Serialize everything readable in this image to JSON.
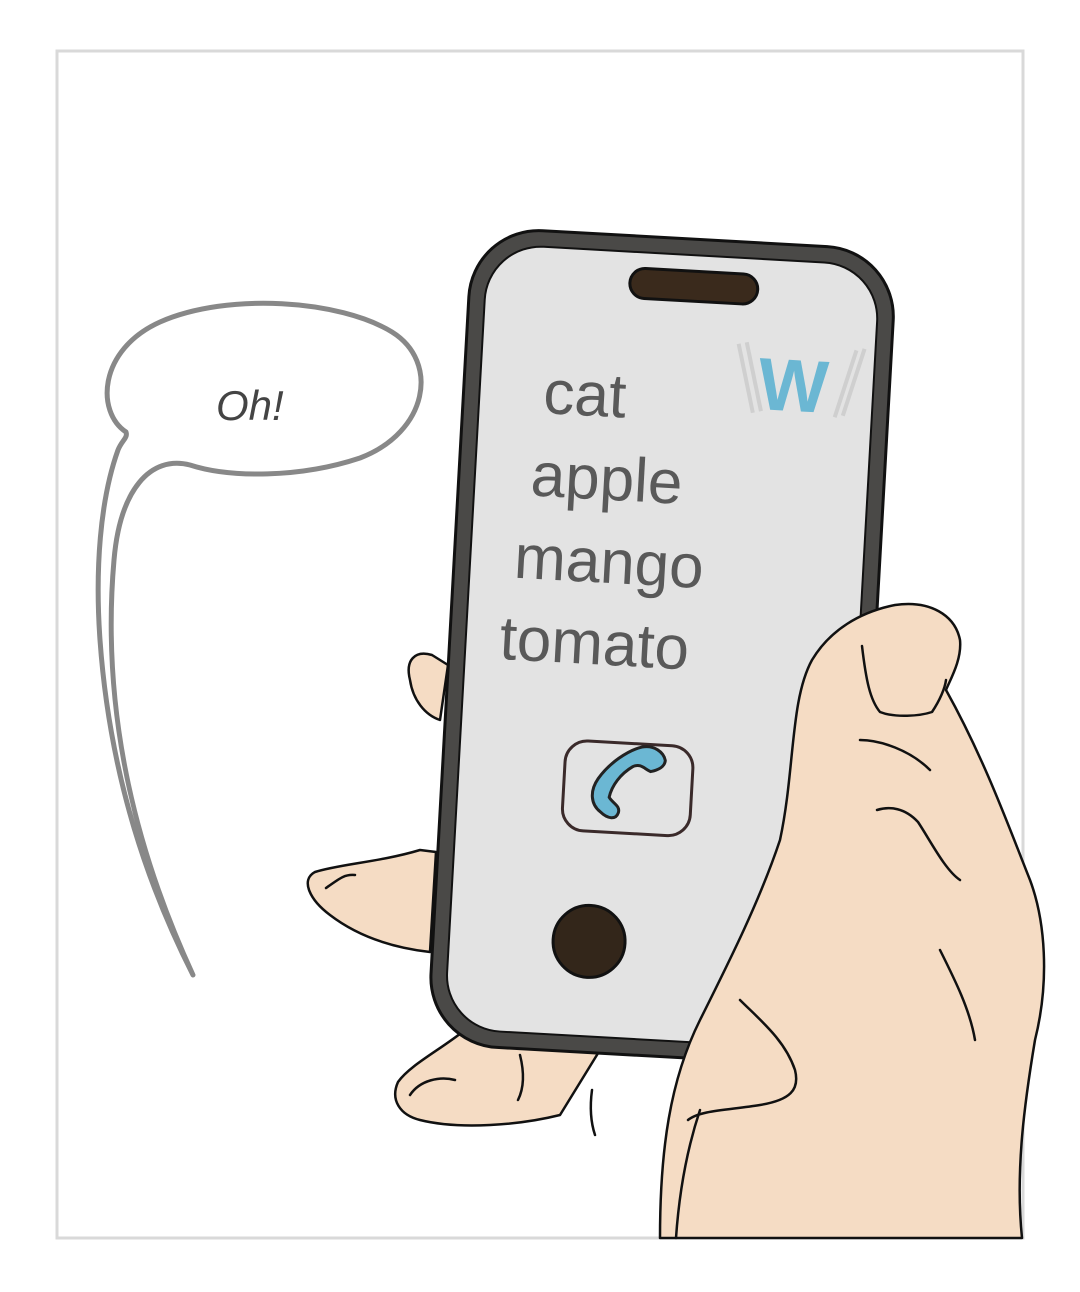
{
  "speech_bubble": {
    "text": "Oh!"
  },
  "phone": {
    "logo": {
      "letter": "W",
      "color": "#6bb7d3"
    },
    "words": [
      "cat",
      "apple",
      "mango",
      "tomato"
    ],
    "call_button": {
      "icon": "phone-icon",
      "color": "#6bb7d3"
    },
    "home_button": {
      "icon": "home-button"
    }
  },
  "colors": {
    "skin": "#f5dcc4",
    "phone_body": "#4a4947",
    "screen": "#e3e3e3",
    "bubble_outline": "#888888",
    "frame": "#d9d9d9"
  }
}
